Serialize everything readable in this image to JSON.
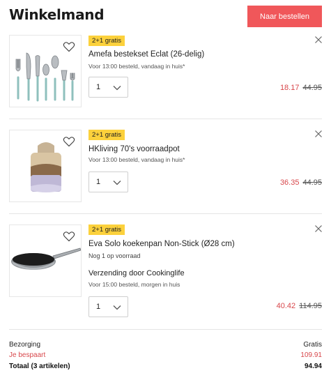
{
  "header": {
    "title": "Winkelmand",
    "checkout_label": "Naar bestellen"
  },
  "items": [
    {
      "badge": "2+1 gratis",
      "name": "Amefa bestekset Eclat (26-delig)",
      "delivery": "Voor 13:00 besteld, vandaag in huis*",
      "quantity": "1",
      "price": "18.17",
      "old_price": "44.95",
      "image_icon": "cutlery-set"
    },
    {
      "badge": "2+1 gratis",
      "name": "HKliving 70's voorraadpot",
      "delivery": "Voor 13:00 besteld, vandaag in huis*",
      "quantity": "1",
      "price": "36.35",
      "old_price": "44.95",
      "image_icon": "storage-jar"
    },
    {
      "badge": "2+1 gratis",
      "name": "Eva Solo koekenpan Non-Stick (Ø28 cm)",
      "stock": "Nog 1 op voorraad",
      "shipping": "Verzending door Cookinglife",
      "delivery": "Voor 15:00 besteld, morgen in huis",
      "quantity": "1",
      "price": "40.42",
      "old_price": "114.95",
      "image_icon": "frying-pan"
    }
  ],
  "summary": {
    "delivery_label": "Bezorging",
    "delivery_value": "Gratis",
    "savings_label": "Je bespaart",
    "savings_value": "109.91",
    "total_label": "Totaal (3 artikelen)",
    "total_value": "94.94"
  },
  "colors": {
    "accent": "#f0575a",
    "price_red": "#d8474b",
    "badge_yellow": "#fcd13c"
  }
}
